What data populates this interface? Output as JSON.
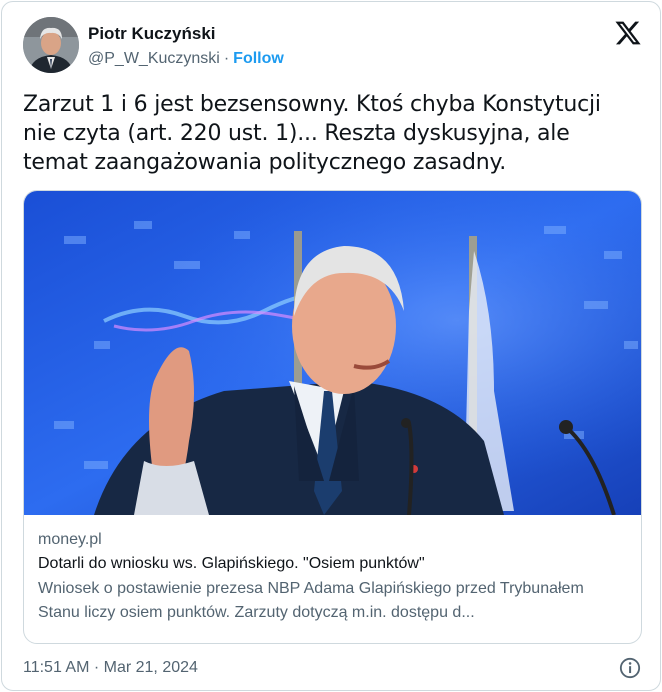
{
  "author": {
    "display_name": "Piotr Kuczyński",
    "handle": "@P_W_Kuczynski",
    "separator": "·",
    "follow_label": "Follow",
    "avatar_icon": "avatar-portrait"
  },
  "brand_icon": "x-logo-icon",
  "tweet": {
    "text": "Zarzut 1 i 6 jest bezsensowny. Ktoś chyba Konstytucji nie czyta (art. 220 ust. 1)... Reszta dyskusyjna, ale temat zaangażowania politycznego zasadny."
  },
  "link_card": {
    "domain": "money.pl",
    "headline": "Dotarli do wniosku ws. Glapińskiego. \"Osiem punktów\"",
    "description": "Wniosek o postawienie prezesa NBP Adama Glapińskiego przed Trybunałem Stanu liczy osiem punktów. Zarzuty dotyczą m.in. dostępu d..."
  },
  "footer": {
    "timestamp": "11:51 AM · Mar 21, 2024",
    "info_icon": "info-icon"
  },
  "colors": {
    "accent": "#1d9bf0",
    "text_primary": "#0f1419",
    "text_secondary": "#536471",
    "border": "#cfd9de"
  }
}
